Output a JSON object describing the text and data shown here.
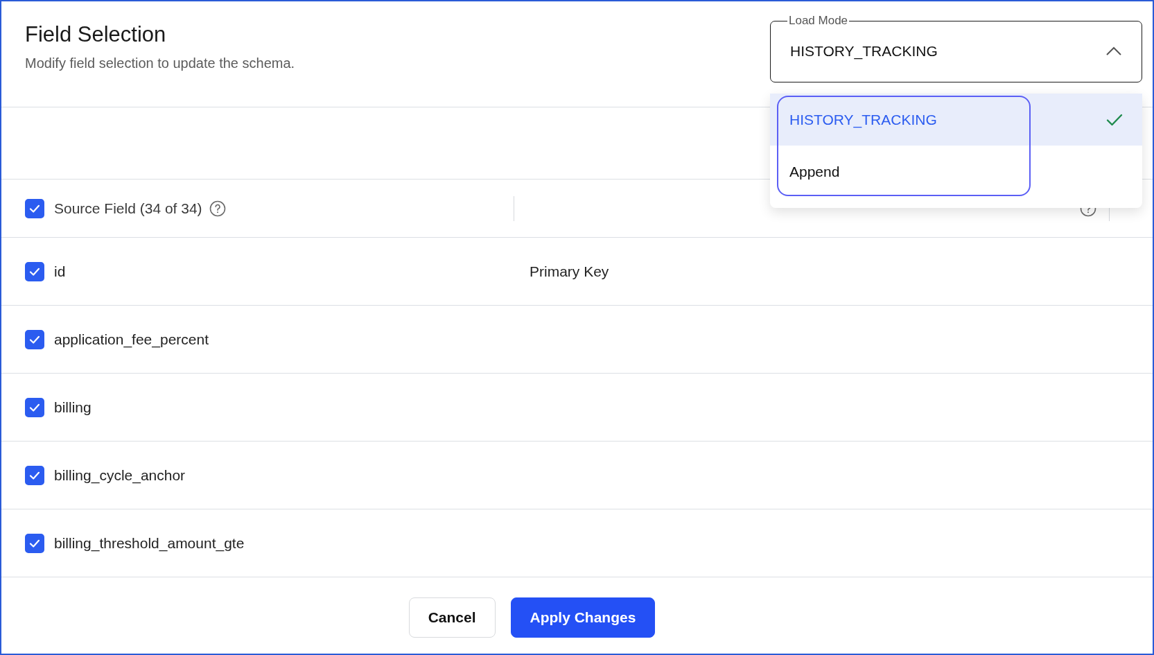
{
  "title": "Field Selection",
  "subtitle": "Modify field selection to update the schema.",
  "load_mode": {
    "label": "Load Mode",
    "value": "HISTORY_TRACKING",
    "expanded": true,
    "options": [
      {
        "label": "HISTORY_TRACKING",
        "selected": true
      },
      {
        "label": "Append",
        "selected": false
      }
    ]
  },
  "table": {
    "header": {
      "label": "Source Field (34 of 34)",
      "checked": true
    },
    "rows": [
      {
        "name": "id",
        "checked": true,
        "column_2": "Primary Key"
      },
      {
        "name": "application_fee_percent",
        "checked": true
      },
      {
        "name": "billing",
        "checked": true
      },
      {
        "name": "billing_cycle_anchor",
        "checked": true
      },
      {
        "name": "billing_threshold_amount_gte",
        "checked": true
      }
    ]
  },
  "buttons": [
    {
      "label": "Cancel",
      "kind": "secondary"
    },
    {
      "label": "Apply Changes",
      "kind": "primary"
    }
  ]
}
